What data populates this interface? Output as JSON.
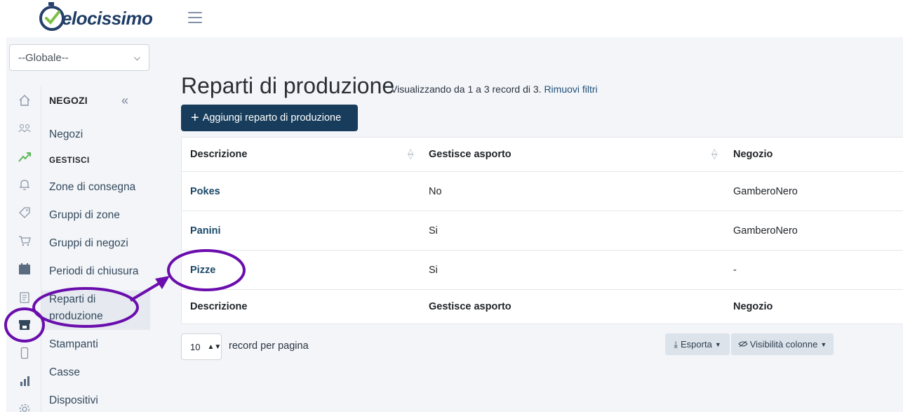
{
  "brand": {
    "logo_text": "elocissimo"
  },
  "store_selector": {
    "selected": "--Globale--"
  },
  "icon_rail": [
    {
      "name": "home-icon"
    },
    {
      "name": "users-icon"
    },
    {
      "name": "trend-icon"
    },
    {
      "name": "bell-icon"
    },
    {
      "name": "tag-icon"
    },
    {
      "name": "cart-icon"
    },
    {
      "name": "calendar-icon"
    },
    {
      "name": "clipboard-icon"
    },
    {
      "name": "store-icon"
    },
    {
      "name": "mobile-icon"
    },
    {
      "name": "bar-chart-icon"
    },
    {
      "name": "gear-icon"
    }
  ],
  "submenu": {
    "header": "NEGOZI",
    "section": "GESTISCI",
    "items": [
      {
        "label": "Negozi"
      },
      {
        "label": "Zone di consegna"
      },
      {
        "label": "Gruppi di zone"
      },
      {
        "label": "Gruppi di negozi"
      },
      {
        "label": "Periodi di chiusura"
      },
      {
        "label": "Reparti di produzione"
      },
      {
        "label": "Stampanti"
      },
      {
        "label": "Casse"
      },
      {
        "label": "Dispositivi"
      }
    ]
  },
  "page": {
    "title": "Reparti di produzione",
    "subtitle": "Visualizzando da 1 a 3 record di 3.",
    "clear_filters": "Rimuovi filtri",
    "add_button": "Aggiungi reparto di produzione"
  },
  "table": {
    "headers": [
      "Descrizione",
      "Gestisce asporto",
      "Negozio"
    ],
    "rows": [
      {
        "descrizione": "Pokes",
        "asporto": "No",
        "negozio": "GamberoNero"
      },
      {
        "descrizione": "Panini",
        "asporto": "Si",
        "negozio": "GamberoNero"
      },
      {
        "descrizione": "Pizze",
        "asporto": "Si",
        "negozio": "-"
      }
    ],
    "footer": [
      "Descrizione",
      "Gestisce asporto",
      "Negozio"
    ]
  },
  "pagination": {
    "per_page": "10",
    "per_page_label": "record per pagina"
  },
  "toolbar": {
    "export": "Esporta",
    "columns": "Visibilità colonne"
  },
  "colors": {
    "primary": "#183d5c",
    "annotation": "#6a0dad",
    "link": "#1a4868"
  }
}
